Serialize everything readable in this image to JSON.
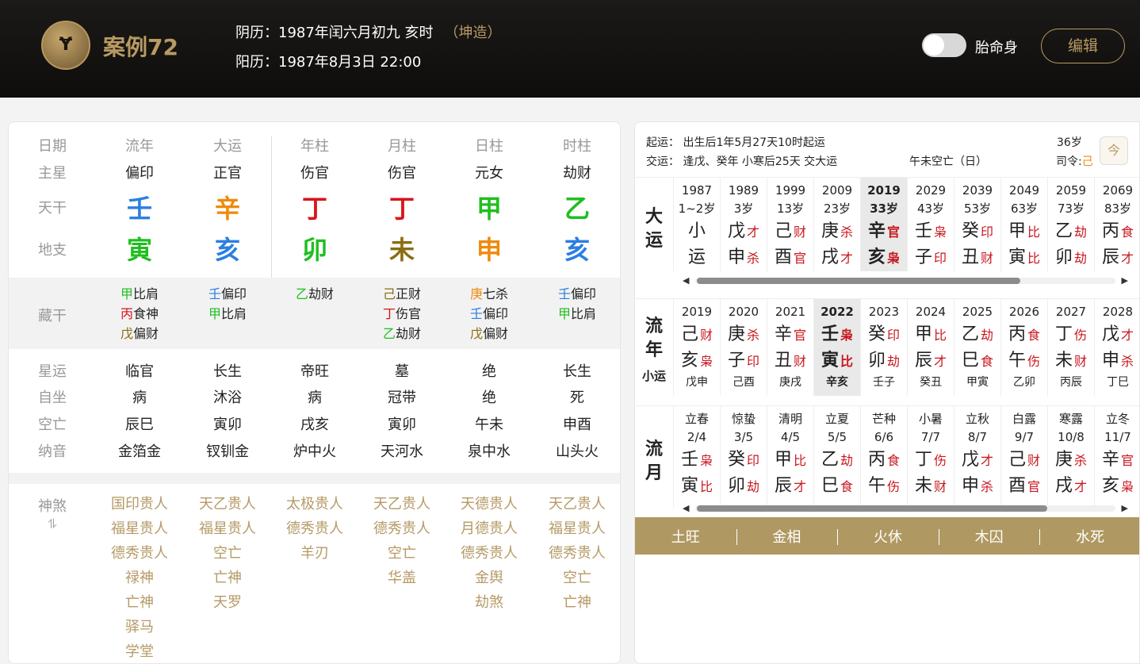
{
  "header": {
    "logo_text": "Ɏ",
    "title": "案例72",
    "lunar": "阴历：1987年闰六月初九 亥时",
    "gender": "（坤造）",
    "solar": "阳历：1987年8月3日 22:00",
    "toggle_label": "胎命身",
    "edit": "编辑"
  },
  "left": {
    "headers": [
      "日期",
      "流年",
      "大运",
      "年柱",
      "月柱",
      "日柱",
      "时柱"
    ],
    "row_labels": {
      "zhuxing": "主星",
      "tiangan": "天干",
      "dizhi": "地支",
      "canggan": "藏干",
      "xingyun": "星运",
      "zizuo": "自坐",
      "kongwang": "空亡",
      "nayin": "纳音",
      "shensha": "神煞",
      "shensha_icon": "⥮"
    },
    "zhuxing": [
      "偏印",
      "正官",
      "伤官",
      "伤官",
      "元女",
      "劫财"
    ],
    "tiangan": [
      {
        "t": "壬",
        "c": "#2b7fe0"
      },
      {
        "t": "辛",
        "c": "#ef8a0c"
      },
      {
        "t": "丁",
        "c": "#d8141d"
      },
      {
        "t": "丁",
        "c": "#d8141d"
      },
      {
        "t": "甲",
        "c": "#1fbf1f"
      },
      {
        "t": "乙",
        "c": "#1fbf1f"
      }
    ],
    "dizhi": [
      {
        "t": "寅",
        "c": "#1fbf1f"
      },
      {
        "t": "亥",
        "c": "#2b7fe0"
      },
      {
        "t": "卯",
        "c": "#1fbf1f"
      },
      {
        "t": "未",
        "c": "#8a6d10"
      },
      {
        "t": "申",
        "c": "#ef8a0c"
      },
      {
        "t": "亥",
        "c": "#2b7fe0"
      }
    ],
    "canggan": [
      [
        {
          "g": "甲",
          "gc": "#1fbf1f",
          "s": "比肩"
        },
        {
          "g": "丙",
          "gc": "#d8141d",
          "s": "食神"
        },
        {
          "g": "戊",
          "gc": "#8a6d10",
          "s": "偏财"
        }
      ],
      [
        {
          "g": "壬",
          "gc": "#2b7fe0",
          "s": "偏印"
        },
        {
          "g": "甲",
          "gc": "#1fbf1f",
          "s": "比肩"
        }
      ],
      [
        {
          "g": "乙",
          "gc": "#1fbf1f",
          "s": "劫财"
        }
      ],
      [
        {
          "g": "己",
          "gc": "#8a6d10",
          "s": "正财"
        },
        {
          "g": "丁",
          "gc": "#d8141d",
          "s": "伤官"
        },
        {
          "g": "乙",
          "gc": "#1fbf1f",
          "s": "劫财"
        }
      ],
      [
        {
          "g": "庚",
          "gc": "#ef8a0c",
          "s": "七杀"
        },
        {
          "g": "壬",
          "gc": "#2b7fe0",
          "s": "偏印"
        },
        {
          "g": "戊",
          "gc": "#8a6d10",
          "s": "偏财"
        }
      ],
      [
        {
          "g": "壬",
          "gc": "#2b7fe0",
          "s": "偏印"
        },
        {
          "g": "甲",
          "gc": "#1fbf1f",
          "s": "比肩"
        }
      ]
    ],
    "xingyun": [
      "临官",
      "长生",
      "帝旺",
      "墓",
      "绝",
      "长生"
    ],
    "zizuo": [
      "病",
      "沐浴",
      "病",
      "冠带",
      "绝",
      "死"
    ],
    "kongwang": [
      "辰巳",
      "寅卯",
      "戌亥",
      "寅卯",
      "午未",
      "申酉"
    ],
    "nayin": [
      "金箔金",
      "钗钏金",
      "炉中火",
      "天河水",
      "泉中水",
      "山头火"
    ],
    "shensha": [
      [
        "国印贵人",
        "福星贵人",
        "德秀贵人",
        "禄神",
        "亡神",
        "驿马",
        "学堂"
      ],
      [
        "天乙贵人",
        "福星贵人",
        "空亡",
        "亡神",
        "天罗"
      ],
      [
        "太极贵人",
        "德秀贵人",
        "羊刃"
      ],
      [
        "天乙贵人",
        "德秀贵人",
        "空亡",
        "华盖"
      ],
      [
        "天德贵人",
        "月德贵人",
        "德秀贵人",
        "金舆",
        "劫煞"
      ],
      [
        "天乙贵人",
        "福星贵人",
        "德秀贵人",
        "空亡",
        "亡神"
      ]
    ]
  },
  "right": {
    "qiyun": "起运： 出生后1年5月27天10时起运",
    "jiaoyun": "交运： 逢戊、癸年 小寒后25天 交大运",
    "kongwang": "午未空亡（日）",
    "age": "36岁",
    "siling": "司令:",
    "siling_val": "己",
    "cal_icon": "今",
    "dayun_label": [
      "大",
      "运"
    ],
    "dayun": [
      {
        "y": "1987",
        "a": "1~2岁",
        "g1": "小",
        "s1": "",
        "g2": "运",
        "s2": "",
        "gc1": "#222",
        "gc2": "#222"
      },
      {
        "y": "1989",
        "a": "3岁",
        "g1": "戊",
        "s1": "才",
        "g2": "申",
        "s2": "杀"
      },
      {
        "y": "1999",
        "a": "13岁",
        "g1": "己",
        "s1": "财",
        "g2": "酉",
        "s2": "官"
      },
      {
        "y": "2009",
        "a": "23岁",
        "g1": "庚",
        "s1": "杀",
        "g2": "戌",
        "s2": "才"
      },
      {
        "y": "2019",
        "a": "33岁",
        "g1": "辛",
        "s1": "官",
        "g2": "亥",
        "s2": "枭",
        "hl": true
      },
      {
        "y": "2029",
        "a": "43岁",
        "g1": "壬",
        "s1": "枭",
        "g2": "子",
        "s2": "印"
      },
      {
        "y": "2039",
        "a": "53岁",
        "g1": "癸",
        "s1": "印",
        "g2": "丑",
        "s2": "财"
      },
      {
        "y": "2049",
        "a": "63岁",
        "g1": "甲",
        "s1": "比",
        "g2": "寅",
        "s2": "比"
      },
      {
        "y": "2059",
        "a": "73岁",
        "g1": "乙",
        "s1": "劫",
        "g2": "卯",
        "s2": "劫"
      },
      {
        "y": "2069",
        "a": "83岁",
        "g1": "丙",
        "s1": "食",
        "g2": "辰",
        "s2": "才"
      }
    ],
    "liunian_label": [
      "流",
      "年"
    ],
    "xiaoyun_label": "小运",
    "liunian": [
      {
        "y": "2019",
        "g1": "己",
        "s1": "财",
        "g2": "亥",
        "s2": "枭",
        "x": "戊申"
      },
      {
        "y": "2020",
        "g1": "庚",
        "s1": "杀",
        "g2": "子",
        "s2": "印",
        "x": "己酉"
      },
      {
        "y": "2021",
        "g1": "辛",
        "s1": "官",
        "g2": "丑",
        "s2": "财",
        "x": "庚戌"
      },
      {
        "y": "2022",
        "g1": "壬",
        "s1": "枭",
        "g2": "寅",
        "s2": "比",
        "x": "辛亥",
        "hl": true
      },
      {
        "y": "2023",
        "g1": "癸",
        "s1": "印",
        "g2": "卯",
        "s2": "劫",
        "x": "壬子"
      },
      {
        "y": "2024",
        "g1": "甲",
        "s1": "比",
        "g2": "辰",
        "s2": "才",
        "x": "癸丑"
      },
      {
        "y": "2025",
        "g1": "乙",
        "s1": "劫",
        "g2": "巳",
        "s2": "食",
        "x": "甲寅"
      },
      {
        "y": "2026",
        "g1": "丙",
        "s1": "食",
        "g2": "午",
        "s2": "伤",
        "x": "乙卯"
      },
      {
        "y": "2027",
        "g1": "丁",
        "s1": "伤",
        "g2": "未",
        "s2": "财",
        "x": "丙辰"
      },
      {
        "y": "2028",
        "g1": "戊",
        "s1": "才",
        "g2": "申",
        "s2": "杀",
        "x": "丁巳"
      }
    ],
    "liuyue_label": [
      "流",
      "月"
    ],
    "liuyue": [
      {
        "n": "立春",
        "d": "2/4",
        "g1": "壬",
        "s1": "枭",
        "g2": "寅",
        "s2": "比"
      },
      {
        "n": "惊蛰",
        "d": "3/5",
        "g1": "癸",
        "s1": "印",
        "g2": "卯",
        "s2": "劫"
      },
      {
        "n": "清明",
        "d": "4/5",
        "g1": "甲",
        "s1": "比",
        "g2": "辰",
        "s2": "才"
      },
      {
        "n": "立夏",
        "d": "5/5",
        "g1": "乙",
        "s1": "劫",
        "g2": "巳",
        "s2": "食"
      },
      {
        "n": "芒种",
        "d": "6/6",
        "g1": "丙",
        "s1": "食",
        "g2": "午",
        "s2": "伤"
      },
      {
        "n": "小暑",
        "d": "7/7",
        "g1": "丁",
        "s1": "伤",
        "g2": "未",
        "s2": "财"
      },
      {
        "n": "立秋",
        "d": "8/7",
        "g1": "戊",
        "s1": "才",
        "g2": "申",
        "s2": "杀"
      },
      {
        "n": "白露",
        "d": "9/7",
        "g1": "己",
        "s1": "财",
        "g2": "酉",
        "s2": "官"
      },
      {
        "n": "寒露",
        "d": "10/8",
        "g1": "庚",
        "s1": "杀",
        "g2": "戌",
        "s2": "才"
      },
      {
        "n": "立冬",
        "d": "11/7",
        "g1": "辛",
        "s1": "官",
        "g2": "亥",
        "s2": "枭"
      }
    ],
    "wuxing": [
      "土旺",
      "金相",
      "火休",
      "木囚",
      "水死"
    ]
  }
}
